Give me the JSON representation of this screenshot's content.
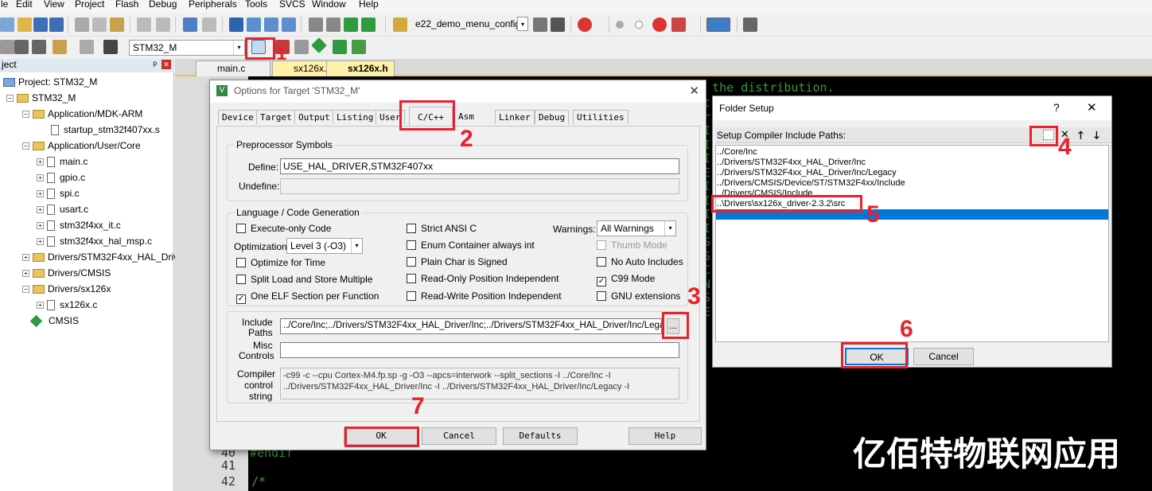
{
  "menu": [
    "le",
    "Edit",
    "View",
    "Project",
    "Flash",
    "Debug",
    "Peripherals",
    "Tools",
    "SVCS",
    "Window",
    "Help"
  ],
  "toolbar": {
    "config_name": "e22_demo_menu_config",
    "target_name": "STM32_M"
  },
  "project_panel": {
    "title": "ject",
    "tree": [
      "Project: STM32_M",
      "STM32_M",
      "Application/MDK-ARM",
      "startup_stm32f407xx.s",
      "Application/User/Core",
      "main.c",
      "gpio.c",
      "spi.c",
      "usart.c",
      "stm32f4xx_it.c",
      "stm32f4xx_hal_msp.c",
      "Drivers/STM32F4xx_HAL_Driv",
      "Drivers/CMSIS",
      "Drivers/sx126x",
      "sx126x.c",
      "CMSIS"
    ]
  },
  "editor": {
    "tabs": [
      "main.c",
      "sx126x.c",
      "sx126x.h"
    ],
    "code_top": "th the distribution.",
    "line_numbers": [
      "40",
      "41",
      "42"
    ],
    "code_lines": [
      "#endif",
      "",
      "/*"
    ],
    "side_chars": [
      "t",
      "r",
      "I",
      "I",
      "I",
      "E",
      "I",
      "I",
      "I",
      "I",
      "S",
      "S",
      "C",
      "N",
      "S",
      "E"
    ]
  },
  "options_dialog": {
    "title": "Options for Target 'STM32_M'",
    "tabs": [
      "Device",
      "Target",
      "Output",
      "Listing",
      "User",
      "C/C++",
      "Asm",
      "Linker",
      "Debug",
      "Utilities"
    ],
    "preprocessor_group": "Preprocessor Symbols",
    "define_label": "Define:",
    "define_value": "USE_HAL_DRIVER,STM32F407xx",
    "undefine_label": "Undefine:",
    "language_group": "Language / Code Generation",
    "execute_only": "Execute-only Code",
    "optimization_label": "Optimization:",
    "optimization_value": "Level 3 (-O3)",
    "optimize_time": "Optimize for Time",
    "split_load": "Split Load and Store Multiple",
    "one_elf": "One ELF Section per Function",
    "strict_ansi": "Strict ANSI C",
    "enum_container": "Enum Container always int",
    "plain_char": "Plain Char is Signed",
    "ro_pos": "Read-Only Position Independent",
    "rw_pos": "Read-Write Position Independent",
    "warnings_label": "Warnings:",
    "warnings_value": "All Warnings",
    "thumb_mode": "Thumb Mode",
    "no_auto_includes": "No Auto Includes",
    "c99_mode": "C99 Mode",
    "gnu_ext": "GNU extensions",
    "include_label_1": "Include",
    "include_label_2": "Paths",
    "include_value": "../Core/Inc;../Drivers/STM32F4xx_HAL_Driver/Inc;../Drivers/STM32F4xx_HAL_Driver/Inc/Legacy;",
    "browse": "...",
    "misc_label_1": "Misc",
    "misc_label_2": "Controls",
    "compiler_label_1": "Compiler",
    "compiler_label_2": "control",
    "compiler_label_3": "string",
    "compiler_line_1": "-c99 -c --cpu Cortex-M4.fp.sp -g -O3 --apcs=interwork --split_sections -I ../Core/Inc -I",
    "compiler_line_2": "../Drivers/STM32F4xx_HAL_Driver/Inc -I ../Drivers/STM32F4xx_HAL_Driver/Inc/Legacy -I",
    "ok": "OK",
    "cancel": "Cancel",
    "defaults": "Defaults",
    "help": "Help"
  },
  "folder_dialog": {
    "title": "Folder Setup",
    "help_glyph": "?",
    "close_glyph": "✕",
    "heading": "Setup Compiler Include Paths:",
    "paths": [
      "../Core/Inc",
      "../Drivers/STM32F4xx_HAL_Driver/Inc",
      "../Drivers/STM32F4xx_HAL_Driver/Inc/Legacy",
      "../Drivers/CMSIS/Device/ST/STM32F4xx/Include",
      "../Drivers/CMSIS/Include",
      "..\\Drivers\\sx126x_driver-2.3.2\\src"
    ],
    "ok": "OK",
    "cancel": "Cancel"
  },
  "annotations": [
    "1",
    "2",
    "3",
    "4",
    "5",
    "6",
    "7"
  ],
  "watermark": "亿佰特物联网应用",
  "colors": {
    "annotation": "#e8212f",
    "selection": "#0078d7",
    "code_green": "#3a9a3a"
  }
}
